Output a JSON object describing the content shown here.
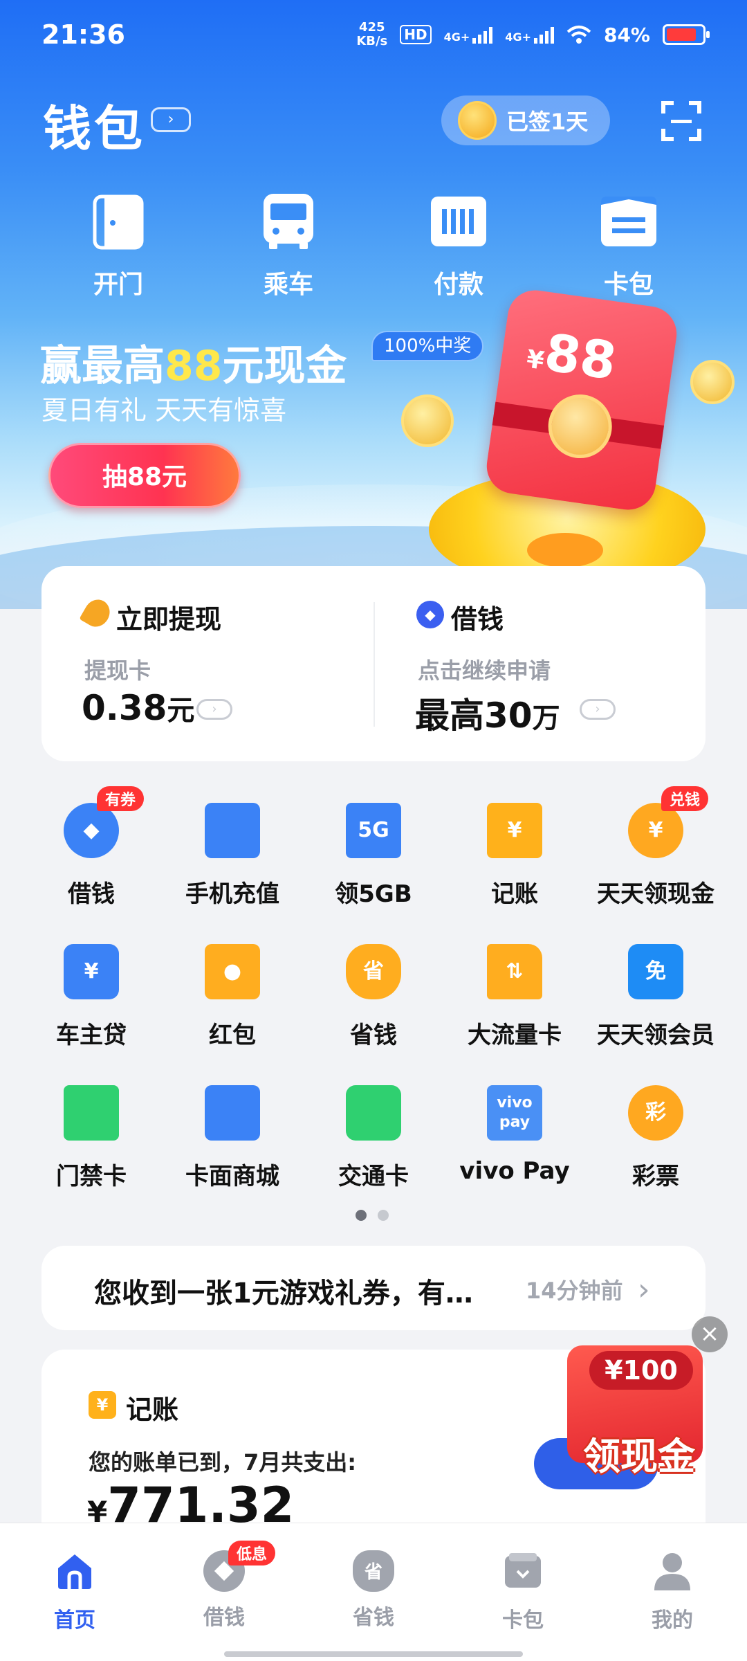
{
  "status_bar": {
    "time": "21:36",
    "net_speed_value": "425",
    "net_speed_unit": "KB/s",
    "hd": "HD",
    "sim1": "4G+",
    "sim2": "4G+",
    "battery": "84%",
    "battery_level": 0.84
  },
  "header": {
    "title": "钱包",
    "chevron": "›",
    "sign_in": "已签1天"
  },
  "quick_actions": [
    {
      "label": "开门",
      "icon": "door-icon"
    },
    {
      "label": "乘车",
      "icon": "bus-icon"
    },
    {
      "label": "付款",
      "icon": "barcode-icon"
    },
    {
      "label": "卡包",
      "icon": "card-wallet-icon"
    }
  ],
  "banner": {
    "title_pre": "赢最高",
    "title_highlight": "88",
    "title_post": "元现金",
    "badge": "100%中奖",
    "subtitle": "夏日有礼 天天有惊喜",
    "button": "抽88元",
    "envelope_currency": "¥",
    "envelope_amount": "88"
  },
  "withdraw_card": {
    "left": {
      "title": "立即提现",
      "sub": "提现卡",
      "value": "0.38",
      "unit": "元"
    },
    "right": {
      "title": "借钱",
      "sub": "点击继续申请",
      "value": "最高30",
      "unit": "万"
    }
  },
  "services": [
    {
      "label": "借钱",
      "icon": "loan-icon",
      "tag": "有券"
    },
    {
      "label": "手机充值",
      "icon": "phone-icon"
    },
    {
      "label": "领5GB",
      "icon": "5g-icon"
    },
    {
      "label": "记账",
      "icon": "ledger-icon"
    },
    {
      "label": "天天领现金",
      "icon": "yuan-coin-icon",
      "tag": "兑钱"
    },
    {
      "label": "车主贷",
      "icon": "car-loan-icon"
    },
    {
      "label": "红包",
      "icon": "red-packet-icon"
    },
    {
      "label": "省钱",
      "icon": "money-bag-icon"
    },
    {
      "label": "大流量卡",
      "icon": "sim-card-icon"
    },
    {
      "label": "天天领会员",
      "icon": "free-diamond-icon"
    },
    {
      "label": "门禁卡",
      "icon": "access-card-icon"
    },
    {
      "label": "卡面商城",
      "icon": "tshirt-icon"
    },
    {
      "label": "交通卡",
      "icon": "transit-card-icon"
    },
    {
      "label": "vivo Pay",
      "icon": "vivo-pay-icon"
    },
    {
      "label": "彩票",
      "icon": "lottery-icon"
    }
  ],
  "icon_glyphs": {
    "yuan": "¥",
    "save": "省",
    "free": "免",
    "lottery": "彩",
    "fiveg": "5G",
    "vivo": "vivo",
    "pay": "pay",
    "sim": "⇅"
  },
  "pager": {
    "pages": 2,
    "current": 1
  },
  "notice": {
    "text": "您收到一张1元游戏礼券，有…",
    "time": "14分钟前",
    "arrow": "›"
  },
  "accounting": {
    "icon_glyph": "¥",
    "title": "记账",
    "desc": "您的账单已到，7月共支出:",
    "currency": "¥",
    "amount": "771.32"
  },
  "float_ad": {
    "close": "×",
    "amount": "¥100",
    "label": "领现金"
  },
  "bottom_nav": [
    {
      "label": "首页",
      "icon": "home-icon",
      "active": true
    },
    {
      "label": "借钱",
      "icon": "loan-icon",
      "badge": "低息"
    },
    {
      "label": "省钱",
      "icon": "money-bag-icon"
    },
    {
      "label": "卡包",
      "icon": "card-wallet-icon"
    },
    {
      "label": "我的",
      "icon": "profile-icon"
    }
  ],
  "colors": {
    "brand_blue": "#1f6ef5",
    "active_nav": "#3160f0",
    "accent_red": "#ff3333",
    "highlight_yellow": "#ffe84a"
  }
}
